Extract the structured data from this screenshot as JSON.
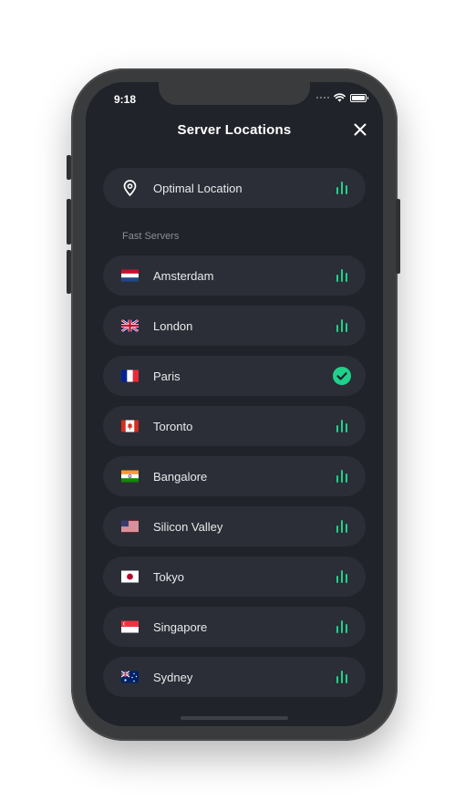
{
  "status_bar": {
    "time": "9:18"
  },
  "header": {
    "title": "Server Locations",
    "close_icon": "close-icon"
  },
  "optimal": {
    "label": "Optimal Location",
    "icon": "location-pin-icon"
  },
  "section": {
    "label": "Fast Servers"
  },
  "servers": [
    {
      "name": "Amsterdam",
      "flag": "netherlands-flag-icon",
      "selected": false
    },
    {
      "name": "London",
      "flag": "uk-flag-icon",
      "selected": false
    },
    {
      "name": "Paris",
      "flag": "france-flag-icon",
      "selected": true
    },
    {
      "name": "Toronto",
      "flag": "canada-flag-icon",
      "selected": false
    },
    {
      "name": "Bangalore",
      "flag": "india-flag-icon",
      "selected": false
    },
    {
      "name": "Silicon Valley",
      "flag": "usa-flag-icon",
      "selected": false
    },
    {
      "name": "Tokyo",
      "flag": "japan-flag-icon",
      "selected": false
    },
    {
      "name": "Singapore",
      "flag": "singapore-flag-icon",
      "selected": false
    },
    {
      "name": "Sydney",
      "flag": "australia-flag-icon",
      "selected": false
    }
  ],
  "colors": {
    "background": "#20232a",
    "row": "#2b2e36",
    "accent": "#1fd18b",
    "text": "#e9eaec",
    "muted": "#8a8e96"
  }
}
